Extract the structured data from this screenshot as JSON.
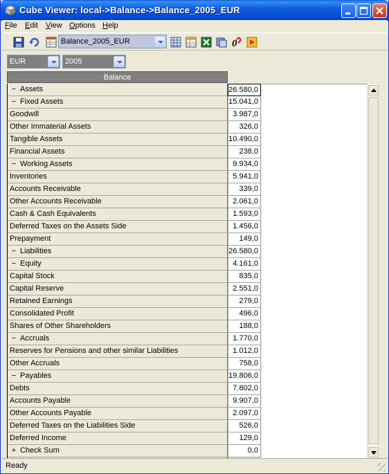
{
  "window": {
    "title": "Cube Viewer:  local->Balance->Balance_2005_EUR"
  },
  "menu": [
    {
      "key": "F",
      "rest": "ile"
    },
    {
      "key": "E",
      "rest": "dit"
    },
    {
      "key": "V",
      "rest": "iew"
    },
    {
      "key": "O",
      "rest": "ptions"
    },
    {
      "key": "H",
      "rest": "elp"
    }
  ],
  "toolbar": {
    "view_selector_value": "Balance_2005_EUR",
    "tools": [
      "save-icon",
      "recalculate-icon",
      "view-icon",
      "grid-icon",
      "spreadsheet-icon",
      "export-icon",
      "zero-suppress-icon",
      "exit-icon"
    ]
  },
  "filters": {
    "currency": "EUR",
    "year": "2005"
  },
  "grid": {
    "column_header": "Balance",
    "rows": [
      {
        "label": "Assets",
        "expander": "−",
        "value": "26.580,0"
      },
      {
        "label": "Fixed Assets",
        "expander": "−",
        "value": "15.041,0"
      },
      {
        "label": "Goodwill",
        "expander": "",
        "value": "3.987,0"
      },
      {
        "label": "Other Immaterial Assets",
        "expander": "",
        "value": "326,0"
      },
      {
        "label": "Tangible Assets",
        "expander": "",
        "value": "10.490,0"
      },
      {
        "label": "Financial Assets",
        "expander": "",
        "value": "238,0"
      },
      {
        "label": "Working Assets",
        "expander": "−",
        "value": "9.934,0"
      },
      {
        "label": "Inventories",
        "expander": "",
        "value": "5.941,0"
      },
      {
        "label": "Accounts Receivable",
        "expander": "",
        "value": "339,0"
      },
      {
        "label": "Other Accounts Receivable",
        "expander": "",
        "value": "2.061,0"
      },
      {
        "label": "Cash & Cash Equivalents",
        "expander": "",
        "value": "1.593,0"
      },
      {
        "label": "Deferred Taxes on the Assets Side",
        "expander": "",
        "value": "1.456,0"
      },
      {
        "label": "Prepayment",
        "expander": "",
        "value": "149,0"
      },
      {
        "label": "Liabilities",
        "expander": "−",
        "value": "26.580,0"
      },
      {
        "label": "Equity",
        "expander": "−",
        "value": "4.161,0"
      },
      {
        "label": "Capital Stock",
        "expander": "",
        "value": "835,0"
      },
      {
        "label": "Capital Reserve",
        "expander": "",
        "value": "2.551,0"
      },
      {
        "label": "Retained Earnings",
        "expander": "",
        "value": "279,0"
      },
      {
        "label": "Consolidated Profit",
        "expander": "",
        "value": "496,0"
      },
      {
        "label": "Shares of Other Shareholders",
        "expander": "",
        "value": "188,0"
      },
      {
        "label": "Accruals",
        "expander": "−",
        "value": "1.770,0"
      },
      {
        "label": "Reserves for Pensions and other similar Liabilities",
        "expander": "",
        "value": "1.012,0"
      },
      {
        "label": "Other Accruals",
        "expander": "",
        "value": "758,0"
      },
      {
        "label": "Payables",
        "expander": "−",
        "value": "19.806,0"
      },
      {
        "label": "Debts",
        "expander": "",
        "value": "7.802,0"
      },
      {
        "label": "Accounts Payable",
        "expander": "",
        "value": "9.907,0"
      },
      {
        "label": "Other Accounts Payable",
        "expander": "",
        "value": "2.097,0"
      },
      {
        "label": "Deferred Taxes on the Liabilities Side",
        "expander": "",
        "value": "526,0"
      },
      {
        "label": "Deferred Income",
        "expander": "",
        "value": "129,0"
      },
      {
        "label": "Check Sum",
        "expander": "+",
        "value": "0,0"
      }
    ]
  },
  "status": {
    "text": "Ready"
  }
}
